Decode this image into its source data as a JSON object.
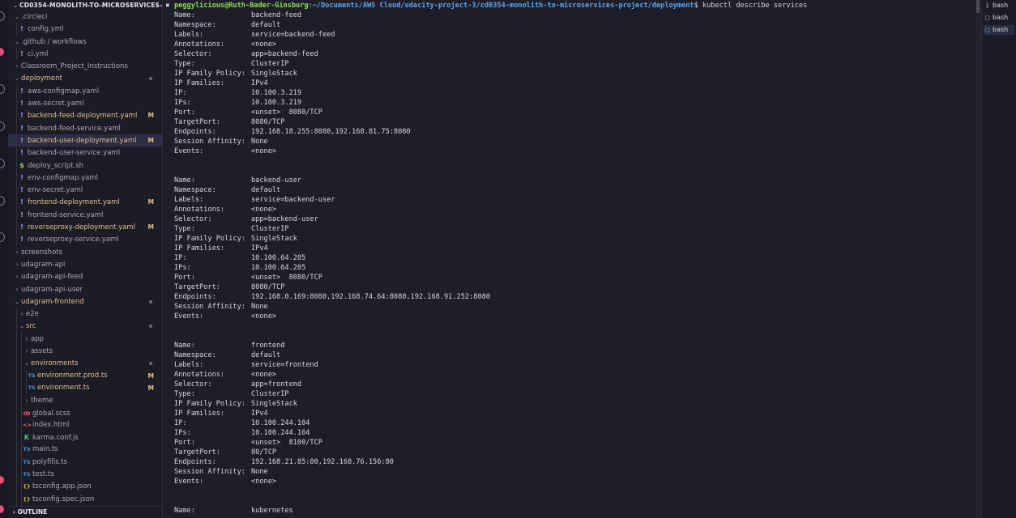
{
  "explorer": {
    "project_title": "CD0354-MONOLITH-TO-MICROSERVICES-PRO...",
    "outline_title": "OUTLINE",
    "items": [
      {
        "label": ".circleci",
        "type": "folder",
        "depth": 1,
        "open": true
      },
      {
        "label": "config.yml",
        "type": "file",
        "icon": "!",
        "iconColor": "#b28ef0",
        "depth": 2
      },
      {
        "label": ".github / workflows",
        "type": "folder",
        "depth": 1,
        "open": true
      },
      {
        "label": "ci.yml",
        "type": "file",
        "icon": "!",
        "iconColor": "#b28ef0",
        "depth": 2
      },
      {
        "label": "Classroom_Project_Instructions",
        "type": "folder",
        "depth": 1,
        "open": false
      },
      {
        "label": "deployment",
        "type": "folder",
        "depth": 1,
        "open": true,
        "modified": true,
        "dot": true
      },
      {
        "label": "aws-configmap.yaml",
        "type": "file",
        "icon": "!",
        "iconColor": "#b28ef0",
        "depth": 2
      },
      {
        "label": "aws-secret.yaml",
        "type": "file",
        "icon": "!",
        "iconColor": "#b28ef0",
        "depth": 2
      },
      {
        "label": "backend-feed-deployment.yaml",
        "type": "file",
        "icon": "!",
        "iconColor": "#b28ef0",
        "depth": 2,
        "modified": true,
        "badge": "M"
      },
      {
        "label": "backend-feed-service.yaml",
        "type": "file",
        "icon": "!",
        "iconColor": "#b28ef0",
        "depth": 2
      },
      {
        "label": "backend-user-deployment.yaml",
        "type": "file",
        "icon": "!",
        "iconColor": "#b28ef0",
        "depth": 2,
        "modified": true,
        "badge": "M",
        "selected": true
      },
      {
        "label": "backend-user-service.yaml",
        "type": "file",
        "icon": "!",
        "iconColor": "#b28ef0",
        "depth": 2
      },
      {
        "label": "deploy_script.sh",
        "type": "file",
        "icon": "$",
        "iconColor": "#8ddc5a",
        "depth": 2
      },
      {
        "label": "env-configmap.yaml",
        "type": "file",
        "icon": "!",
        "iconColor": "#b28ef0",
        "depth": 2
      },
      {
        "label": "env-secret.yaml",
        "type": "file",
        "icon": "!",
        "iconColor": "#b28ef0",
        "depth": 2
      },
      {
        "label": "frontend-deployment.yaml",
        "type": "file",
        "icon": "!",
        "iconColor": "#b28ef0",
        "depth": 2,
        "modified": true,
        "badge": "M"
      },
      {
        "label": "frontend-service.yaml",
        "type": "file",
        "icon": "!",
        "iconColor": "#b28ef0",
        "depth": 2
      },
      {
        "label": "reverseproxy-deployment.yaml",
        "type": "file",
        "icon": "!",
        "iconColor": "#b28ef0",
        "depth": 2,
        "modified": true,
        "badge": "M"
      },
      {
        "label": "reverseproxy-service.yaml",
        "type": "file",
        "icon": "!",
        "iconColor": "#b28ef0",
        "depth": 2
      },
      {
        "label": "screenshots",
        "type": "folder",
        "depth": 1,
        "open": false
      },
      {
        "label": "udagram-api",
        "type": "folder",
        "depth": 1,
        "open": false
      },
      {
        "label": "udagram-api-feed",
        "type": "folder",
        "depth": 1,
        "open": false
      },
      {
        "label": "udagram-api-user",
        "type": "folder",
        "depth": 1,
        "open": false
      },
      {
        "label": "udagram-frontend",
        "type": "folder",
        "depth": 1,
        "open": true,
        "modified": true,
        "dot": true
      },
      {
        "label": "e2e",
        "type": "folder",
        "depth": 2,
        "open": false
      },
      {
        "label": "src",
        "type": "folder",
        "depth": 2,
        "open": true,
        "modified": true,
        "dot": true
      },
      {
        "label": "app",
        "type": "folder",
        "depth": 3,
        "open": false
      },
      {
        "label": "assets",
        "type": "folder",
        "depth": 3,
        "open": false
      },
      {
        "label": "environments",
        "type": "folder",
        "depth": 3,
        "open": true,
        "modified": true,
        "dot": true
      },
      {
        "label": "environment.prod.ts",
        "type": "file",
        "icon": "TS",
        "iconColor": "#4b8fd6",
        "depth": 4,
        "modified": true,
        "badge": "M"
      },
      {
        "label": "environment.ts",
        "type": "file",
        "icon": "TS",
        "iconColor": "#4b8fd6",
        "depth": 4,
        "modified": true,
        "badge": "M"
      },
      {
        "label": "theme",
        "type": "folder",
        "depth": 3,
        "open": false
      },
      {
        "label": "global.scss",
        "type": "file",
        "icon": "ꝏ",
        "iconColor": "#e0507a",
        "depth": 3
      },
      {
        "label": "index.html",
        "type": "file",
        "icon": "<>",
        "iconColor": "#e3774a",
        "depth": 3
      },
      {
        "label": "karma.conf.js",
        "type": "file",
        "icon": "K",
        "iconColor": "#5fc07a",
        "depth": 3
      },
      {
        "label": "main.ts",
        "type": "file",
        "icon": "TS",
        "iconColor": "#4b8fd6",
        "depth": 3
      },
      {
        "label": "polyfills.ts",
        "type": "file",
        "icon": "TS",
        "iconColor": "#4b8fd6",
        "depth": 3
      },
      {
        "label": "test.ts",
        "type": "file",
        "icon": "TS",
        "iconColor": "#4b8fd6",
        "depth": 3
      },
      {
        "label": "tsconfig.app.json",
        "type": "file",
        "icon": "{}",
        "iconColor": "#e3c14a",
        "depth": 3
      },
      {
        "label": "tsconfig.spec.json",
        "type": "file",
        "icon": "{}",
        "iconColor": "#e3c14a",
        "depth": 3
      }
    ]
  },
  "terminal": {
    "prompt_user": "peggylicious@Ruth-Bader-Ginsburg",
    "prompt_path": ":~/Documents/AWS Cloud/udacity-project-3/cd0354-monolith-to-microservices-project/deployment",
    "prompt_command": "$ kubectl describe services",
    "services": [
      {
        "fields": [
          [
            "Name:",
            "backend-feed"
          ],
          [
            "Namespace:",
            "default"
          ],
          [
            "Labels:",
            "service=backend-feed"
          ],
          [
            "Annotations:",
            "<none>"
          ],
          [
            "Selector:",
            "app=backend-feed"
          ],
          [
            "Type:",
            "ClusterIP"
          ],
          [
            "IP Family Policy:",
            "SingleStack"
          ],
          [
            "IP Families:",
            "IPv4"
          ],
          [
            "IP:",
            "10.100.3.219"
          ],
          [
            "IPs:",
            "10.100.3.219"
          ],
          [
            "Port:",
            "<unset>  8080/TCP"
          ],
          [
            "TargetPort:",
            "8080/TCP"
          ],
          [
            "Endpoints:",
            "192.168.18.255:8080,192.168.81.75:8080"
          ],
          [
            "Session Affinity:",
            "None"
          ],
          [
            "Events:",
            "<none>"
          ]
        ]
      },
      {
        "fields": [
          [
            "Name:",
            "backend-user"
          ],
          [
            "Namespace:",
            "default"
          ],
          [
            "Labels:",
            "service=backend-user"
          ],
          [
            "Annotations:",
            "<none>"
          ],
          [
            "Selector:",
            "app=backend-user"
          ],
          [
            "Type:",
            "ClusterIP"
          ],
          [
            "IP Family Policy:",
            "SingleStack"
          ],
          [
            "IP Families:",
            "IPv4"
          ],
          [
            "IP:",
            "10.100.64.205"
          ],
          [
            "IPs:",
            "10.100.64.205"
          ],
          [
            "Port:",
            "<unset>  8080/TCP"
          ],
          [
            "TargetPort:",
            "8080/TCP"
          ],
          [
            "Endpoints:",
            "192.168.0.169:8080,192.168.74.64:8080,192.168.91.252:8080"
          ],
          [
            "Session Affinity:",
            "None"
          ],
          [
            "Events:",
            "<none>"
          ]
        ]
      },
      {
        "fields": [
          [
            "Name:",
            "frontend"
          ],
          [
            "Namespace:",
            "default"
          ],
          [
            "Labels:",
            "service=frontend"
          ],
          [
            "Annotations:",
            "<none>"
          ],
          [
            "Selector:",
            "app=frontend"
          ],
          [
            "Type:",
            "ClusterIP"
          ],
          [
            "IP Family Policy:",
            "SingleStack"
          ],
          [
            "IP Families:",
            "IPv4"
          ],
          [
            "IP:",
            "10.100.244.104"
          ],
          [
            "IPs:",
            "10.100.244.104"
          ],
          [
            "Port:",
            "<unset>  8100/TCP"
          ],
          [
            "TargetPort:",
            "80/TCP"
          ],
          [
            "Endpoints:",
            "192.168.21.85:80,192.168.76.156:80"
          ],
          [
            "Session Affinity:",
            "None"
          ],
          [
            "Events:",
            "<none>"
          ]
        ]
      },
      {
        "fields": [
          [
            "Name:",
            "kubernetes"
          ]
        ]
      }
    ]
  },
  "terminal_tabs": [
    {
      "label": "bash",
      "icon": "split-terminal-icon"
    },
    {
      "label": "bash",
      "icon": "terminal-icon"
    },
    {
      "label": "bash",
      "icon": "terminal-icon",
      "active": true
    }
  ]
}
